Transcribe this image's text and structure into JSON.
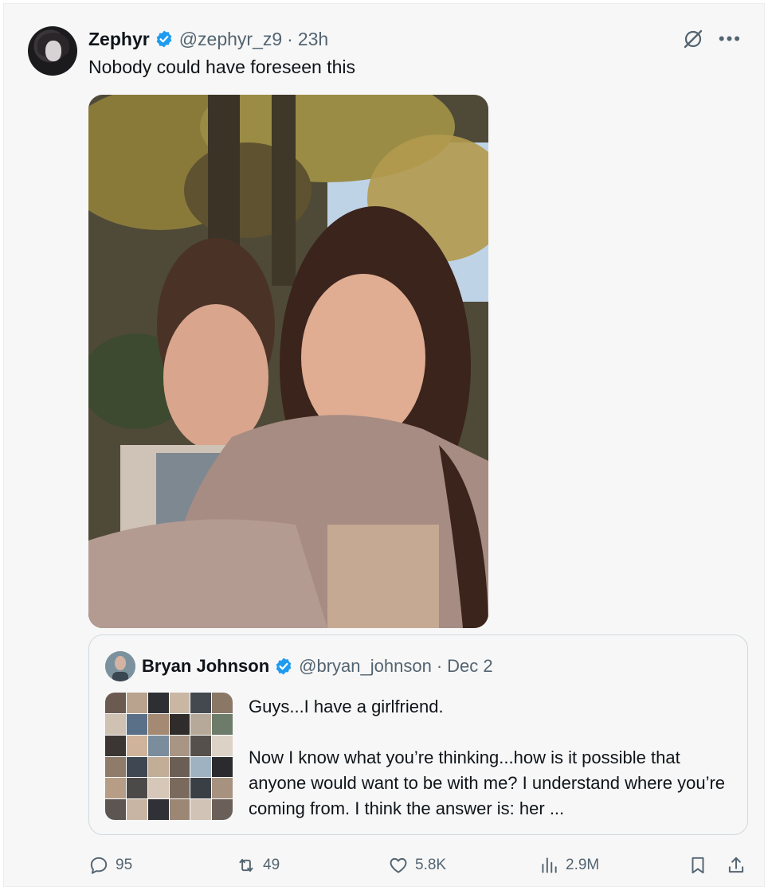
{
  "tweet": {
    "author_name": "Zephyr",
    "handle": "@zephyr_z9",
    "separator": "·",
    "time": "23h",
    "text": "Nobody could have foreseen this"
  },
  "quoted": {
    "author_name": "Bryan Johnson",
    "handle": "@bryan_johnson",
    "separator": "·",
    "date": "Dec 2",
    "line1": "Guys...I have a girlfriend.",
    "line2": "Now I know what you’re thinking...how is it possible that anyone would want to be with me? I understand where you’re coming from. I think the answer is: her ..."
  },
  "stats": {
    "replies": "95",
    "reposts": "49",
    "likes": "5.8K",
    "views": "2.9M"
  },
  "icons": {
    "verified": "verified-badge-icon",
    "grok": "grok-icon",
    "more": "more-icon",
    "reply": "reply-icon",
    "repost": "repost-icon",
    "like": "heart-icon",
    "views": "views-icon",
    "bookmark": "bookmark-icon",
    "share": "share-icon"
  },
  "colors": {
    "verified": "#1d9bf0",
    "muted_text": "#536471",
    "primary_text": "#0f1419",
    "border": "#cfd9de"
  }
}
